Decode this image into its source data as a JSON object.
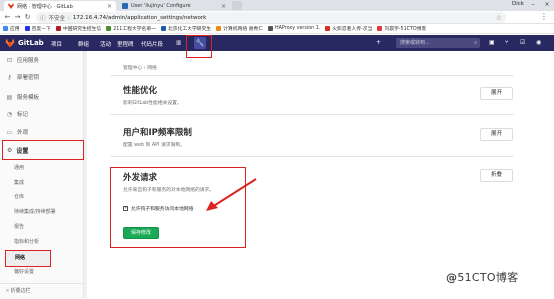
{
  "browser": {
    "tabs": [
      {
        "title": "网络 · 管理中心 · GitLab",
        "active": true,
        "favicon_color": "#e24329"
      },
      {
        "title": "User 'liujinyu' Configure",
        "active": false,
        "favicon_color": "#2b6cb0"
      }
    ],
    "owner": "Dick",
    "url_warning": "不安全",
    "url": "172.16.4.74/admin/application_settings/network",
    "bookmarks": [
      {
        "label": "应用",
        "color": "#4285f4"
      },
      {
        "label": "百度一下",
        "color": "#2932e1"
      },
      {
        "label": "中国研究生招生信",
        "color": "#b01e23"
      },
      {
        "label": "211工程大学名单一",
        "color": "#4a8f2c"
      },
      {
        "label": "北京化工大学研究生",
        "color": "#1e5aa8"
      },
      {
        "label": "计算机网络 谢希仁",
        "color": "#e98b1c"
      },
      {
        "label": "HAProxy version 1.",
        "color": "#555555"
      },
      {
        "label": "火影忍者人传-次当",
        "color": "#d93025"
      },
      {
        "label": "刘晨宇-51CTO博客",
        "color": "#e4393c"
      }
    ]
  },
  "gitlab": {
    "brand": "GitLab",
    "nav": [
      "项目",
      "群组",
      "活动",
      "里程碑",
      "代码片段"
    ],
    "search_placeholder": "搜索或转到..."
  },
  "sidebar": {
    "items": [
      {
        "label": "应用服务",
        "icon": "app-icon"
      },
      {
        "label": "部署密钥",
        "icon": "key-icon"
      },
      {
        "label": "服务模板",
        "icon": "template-icon"
      },
      {
        "label": "标记",
        "icon": "label-icon"
      },
      {
        "label": "外观",
        "icon": "appearance-icon"
      }
    ],
    "settings_label": "设置",
    "sub_items": [
      "通用",
      "集成",
      "仓库",
      "持续集成/持续部署",
      "报告",
      "指标和分析"
    ],
    "network_label": "网络",
    "preferences_label": "偏好设置",
    "collapse_label": "折叠边栏"
  },
  "main": {
    "breadcrumb": [
      "管理中心",
      "网络"
    ],
    "sections": [
      {
        "title": "性能优化",
        "desc": "影响GitLab性能相关设置。",
        "button": "展开"
      },
      {
        "title": "用户和IP频率限制",
        "desc": "配置 web 和 API 请求限制。",
        "button": "展开"
      },
      {
        "title": "外发请求",
        "desc": "允许来自钩子和服务的对本地网络的请求。",
        "button": "折叠"
      }
    ],
    "checkbox_label": "允许钩子和服务访问本地网络",
    "checkbox_checked": true,
    "save_button": "保存修改"
  },
  "watermark": {
    "prefix": "@",
    "text": "51CTO博客"
  },
  "colors": {
    "header": "#292961",
    "accent_red": "#dd2222",
    "save_green": "#1aaa55"
  }
}
